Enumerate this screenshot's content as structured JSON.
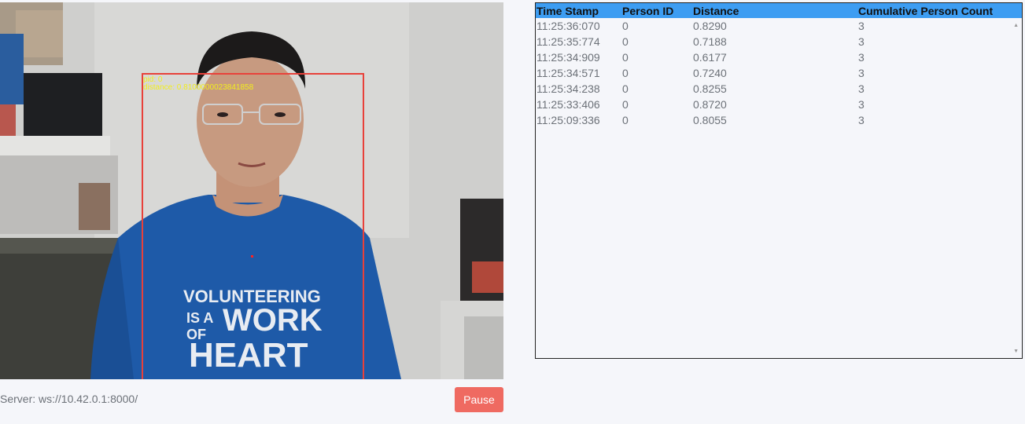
{
  "video": {
    "detection": {
      "pid_label": "pid: 0",
      "distance_label": "distance: 0.8100000023841858"
    },
    "shirt_lines": [
      "VOLUNTEERING",
      "IS A",
      "WORK",
      "OF",
      "HEART"
    ]
  },
  "server": {
    "label": "Server: ws://10.42.0.1:8000/"
  },
  "controls": {
    "pause_label": "Pause"
  },
  "table": {
    "columns": [
      "Time Stamp",
      "Person ID",
      "Distance",
      "Cumulative Person Count"
    ],
    "rows": [
      [
        "11:25:36:070",
        "0",
        "0.8290",
        "3"
      ],
      [
        "11:25:35:774",
        "0",
        "0.7188",
        "3"
      ],
      [
        "11:25:34:909",
        "0",
        "0.6177",
        "3"
      ],
      [
        "11:25:34:571",
        "0",
        "0.7240",
        "3"
      ],
      [
        "11:25:34:238",
        "0",
        "0.8255",
        "3"
      ],
      [
        "11:25:33:406",
        "0",
        "0.8720",
        "3"
      ],
      [
        "11:25:09:336",
        "0",
        "0.8055",
        "3"
      ]
    ]
  },
  "colors": {
    "header": "#3d9df2",
    "pause_button": "#ef6a61",
    "detection_box": "#e8413a",
    "detection_text": "#f2ee1c"
  }
}
